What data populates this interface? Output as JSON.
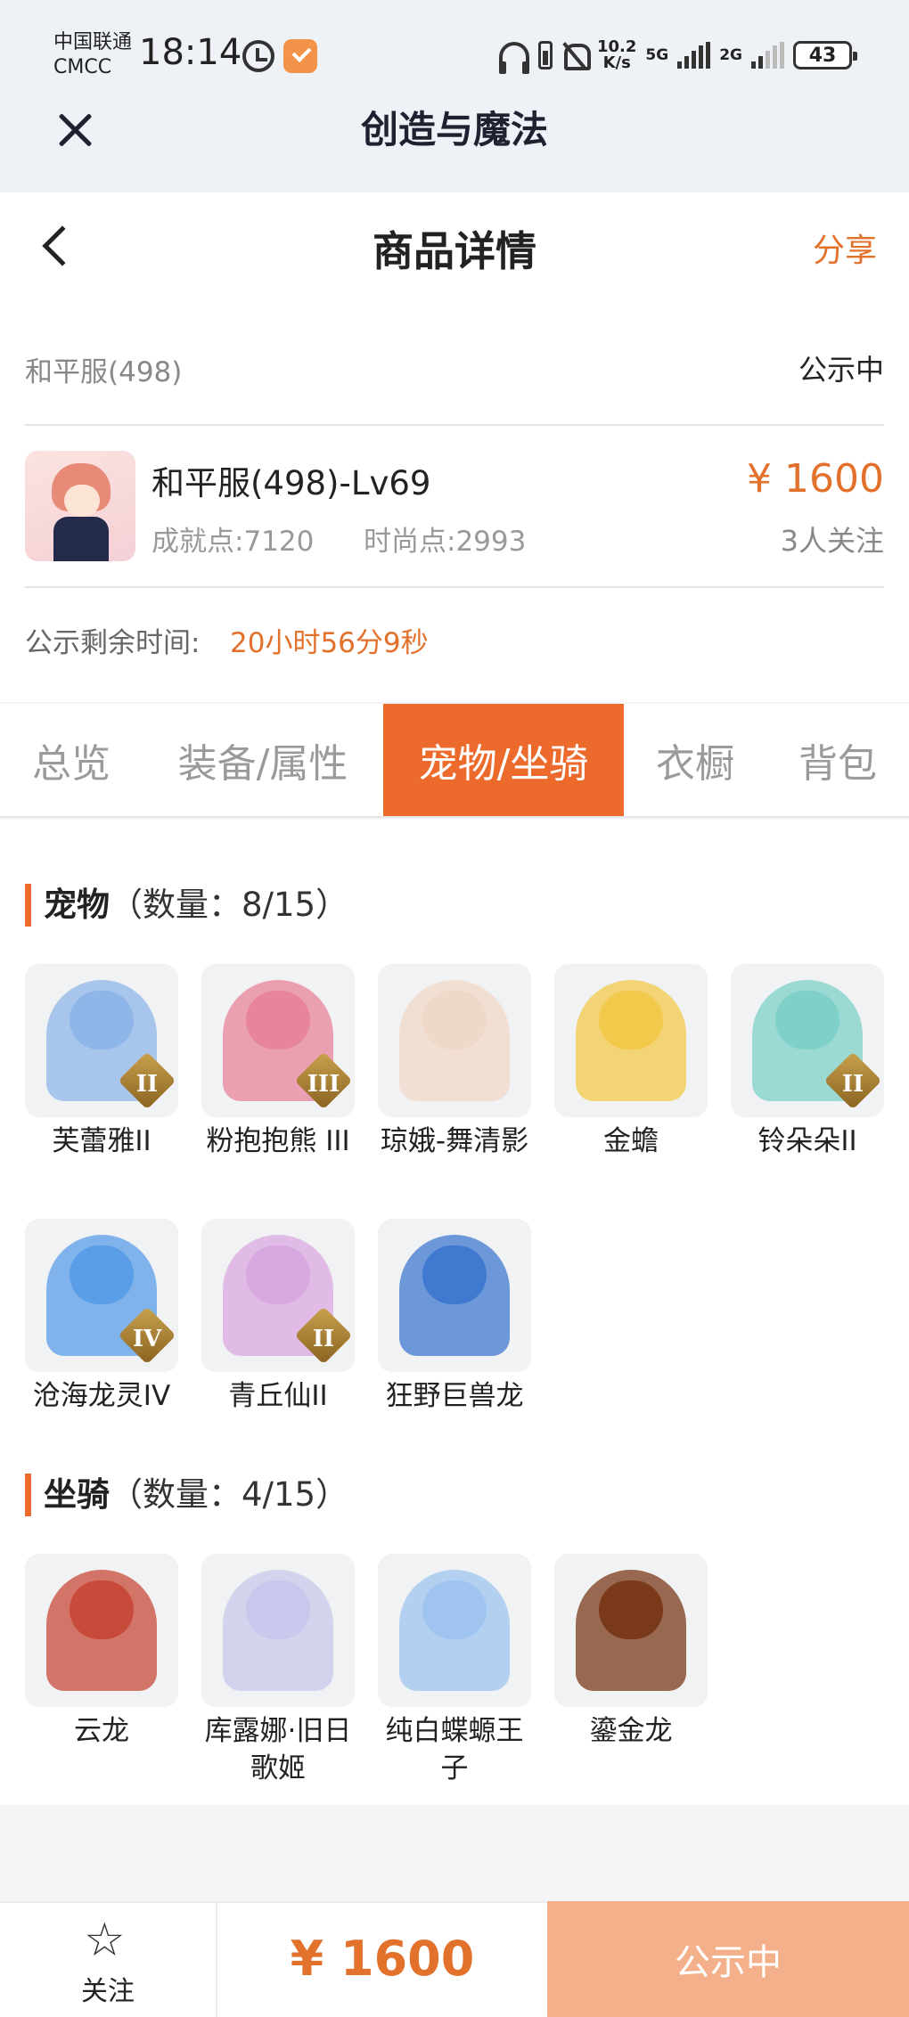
{
  "status_bar": {
    "carrier_line1": "中国联通",
    "carrier_line2": "CMCC",
    "time": "18:14",
    "speed_value": "10.2",
    "speed_unit": "K/s",
    "net1": "5G",
    "net2": "2G",
    "battery": "43"
  },
  "app": {
    "title": "创造与魔法"
  },
  "header": {
    "title": "商品详情",
    "share": "分享"
  },
  "listing": {
    "server": "和平服(498)",
    "status": "公示中",
    "character_name": "和平服(498)-Lv69",
    "achievement": "成就点:7120",
    "fashion": "时尚点:2993",
    "price": "¥ 1600",
    "followers": "3人关注",
    "timer_label": "公示剩余时间:",
    "timer_value": "20小时56分9秒"
  },
  "tabs": [
    {
      "label": "总览",
      "active": false
    },
    {
      "label": "装备/属性",
      "active": false
    },
    {
      "label": "宠物/坐骑",
      "active": true
    },
    {
      "label": "衣橱",
      "active": false
    },
    {
      "label": "背包",
      "active": false
    }
  ],
  "pets": {
    "title": "宠物",
    "count": "（数量：8/15）",
    "items": [
      {
        "name": "芙蕾雅II",
        "rank": "II",
        "color": "#8fb6e8"
      },
      {
        "name": "粉抱抱熊 III",
        "rank": "III",
        "color": "#e8849c"
      },
      {
        "name": "琼娥-舞清影",
        "rank": "",
        "color": "#f0d8c8"
      },
      {
        "name": "金蟾",
        "rank": "",
        "color": "#f2c94a"
      },
      {
        "name": "铃朵朵II",
        "rank": "II",
        "color": "#7ed0c8"
      },
      {
        "name": "沧海龙灵IV",
        "rank": "IV",
        "color": "#5a9ee8"
      },
      {
        "name": "青丘仙II",
        "rank": "II",
        "color": "#d8a8e0"
      },
      {
        "name": "狂野巨兽龙",
        "rank": "",
        "color": "#3f7ad0"
      }
    ]
  },
  "mounts": {
    "title": "坐骑",
    "count": "（数量：4/15）",
    "items": [
      {
        "name": "云龙",
        "rank": "",
        "color": "#c84a3a"
      },
      {
        "name": "库露娜·旧日歌姬",
        "rank": "",
        "color": "#c8c8ec"
      },
      {
        "name": "纯白蝶螈王子",
        "rank": "",
        "color": "#9fc4f0"
      },
      {
        "name": "鎏金龙",
        "rank": "",
        "color": "#7a3a1a"
      }
    ]
  },
  "bottom": {
    "follow": "关注",
    "price": "¥ 1600",
    "status_button": "公示中"
  },
  "colors": {
    "accent": "#ec6a2c",
    "price": "#e2712c",
    "button": "#f4b08a"
  }
}
